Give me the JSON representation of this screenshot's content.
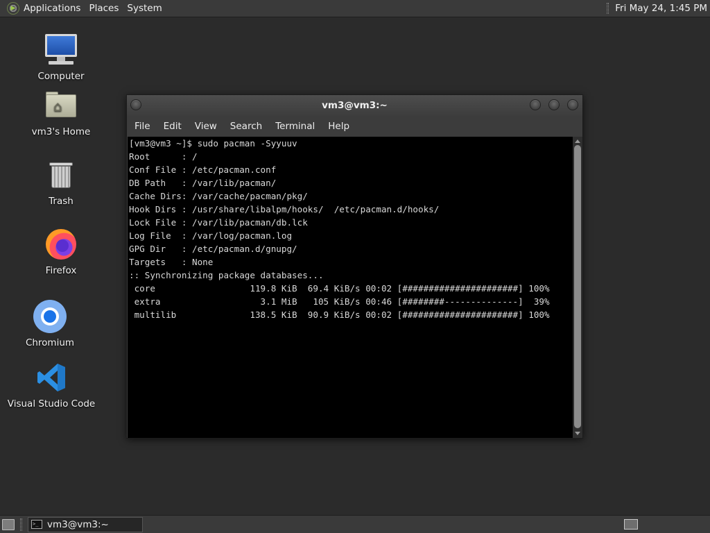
{
  "top_panel": {
    "menus": [
      "Applications",
      "Places",
      "System"
    ],
    "clock": "Fri May 24,  1:45 PM"
  },
  "desktop_icons": [
    {
      "label": "Computer",
      "icon": "computer-icon"
    },
    {
      "label": "vm3's Home",
      "icon": "home-folder-icon"
    },
    {
      "label": "Trash",
      "icon": "trash-icon"
    },
    {
      "label": "Firefox",
      "icon": "firefox-icon"
    },
    {
      "label": "Chromium",
      "icon": "chromium-icon"
    },
    {
      "label": "Visual Studio Code",
      "icon": "vscode-icon"
    }
  ],
  "terminal": {
    "title": "vm3@vm3:~",
    "menu": [
      "File",
      "Edit",
      "View",
      "Search",
      "Terminal",
      "Help"
    ],
    "lines": [
      "[vm3@vm3 ~]$ sudo pacman -Syyuuv",
      "Root      : /",
      "Conf File : /etc/pacman.conf",
      "DB Path   : /var/lib/pacman/",
      "Cache Dirs: /var/cache/pacman/pkg/",
      "Hook Dirs : /usr/share/libalpm/hooks/  /etc/pacman.d/hooks/",
      "Lock File : /var/lib/pacman/db.lck",
      "Log File  : /var/log/pacman.log",
      "GPG Dir   : /etc/pacman.d/gnupg/",
      "Targets   : None",
      ":: Synchronizing package databases...",
      " core                  119.8 KiB  69.4 KiB/s 00:02 [######################] 100%",
      " extra                   3.1 MiB   105 KiB/s 00:46 [########--------------]  39%",
      " multilib              138.5 KiB  90.9 KiB/s 00:02 [######################] 100%"
    ]
  },
  "taskbar": {
    "task_label": "vm3@vm3:~",
    "task_icon_text": ">_"
  },
  "colors": {
    "desktop_bg": "#2b2b2b",
    "panel_bg": "#3a3a3a",
    "terminal_bg": "#000000",
    "terminal_fg": "#d8d8d8"
  }
}
